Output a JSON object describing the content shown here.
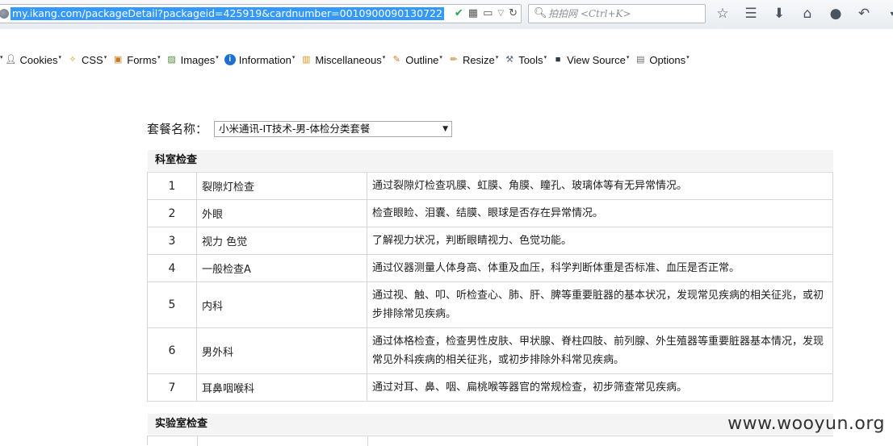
{
  "browser": {
    "url": "my.ikang.com/packageDetail?packageid=425919&cardnumber=0010900090130722",
    "search_placeholder": "拍拍网 <Ctrl+K>"
  },
  "devtoolbar": {
    "items": [
      {
        "label": "Cookies",
        "icon": "person-icon",
        "color": "#333333"
      },
      {
        "label": "CSS",
        "icon": "wand-icon",
        "color": "#d79a1f"
      },
      {
        "label": "Forms",
        "icon": "clipboard-icon",
        "color": "#c8791d"
      },
      {
        "label": "Images",
        "icon": "picture-icon",
        "color": "#4f8a3c"
      },
      {
        "label": "Information",
        "icon": "info-icon",
        "color": "#1f6fd1"
      },
      {
        "label": "Miscellaneous",
        "icon": "notebook-icon",
        "color": "#d7941a"
      },
      {
        "label": "Outline",
        "icon": "pencil-icon",
        "color": "#c8791d"
      },
      {
        "label": "Resize",
        "icon": "ruler-icon",
        "color": "#c8791d"
      },
      {
        "label": "Tools",
        "icon": "tools-icon",
        "color": "#5a6a7a"
      },
      {
        "label": "View Source",
        "icon": "monitor-icon",
        "color": "#2f3a44"
      },
      {
        "label": "Options",
        "icon": "options-icon",
        "color": "#6a6a6a"
      }
    ]
  },
  "package": {
    "label": "套餐名称：",
    "selected": "小米通讯-IT技术-男-体检分类套餐"
  },
  "sections": {
    "department": "科室检查",
    "lab": "实验室检查"
  },
  "rows": [
    {
      "num": "1",
      "name": "裂隙灯检查",
      "desc": "通过裂隙灯检查巩膜、虹膜、角膜、瞳孔、玻璃体等有无异常情况。"
    },
    {
      "num": "2",
      "name": "外眼",
      "desc": "检查眼睑、泪囊、结膜、眼球是否存在异常情况。"
    },
    {
      "num": "3",
      "name": "视力 色觉",
      "desc": "了解视力状况，判断眼睛视力、色觉功能。"
    },
    {
      "num": "4",
      "name": "一般检查A",
      "desc": "通过仪器测量人体身高、体重及血压，科学判断体重是否标准、血压是否正常。"
    },
    {
      "num": "5",
      "name": "内科",
      "desc": "通过视、触、叩、听检查心、肺、肝、脾等重要脏器的基本状况，发现常见疾病的相关征兆，或初步排除常见疾病。"
    },
    {
      "num": "6",
      "name": "男外科",
      "desc": "通过体格检查，检查男性皮肤、甲状腺、脊柱四肢、前列腺、外生殖器等重要脏器基本情况，发现常见外科疾病的相关征兆，或初步排除外科常见疾病。"
    },
    {
      "num": "7",
      "name": "耳鼻咽喉科",
      "desc": "通过对耳、鼻、咽、扁桃喉等器官的常规检查，初步筛查常见疾病。"
    }
  ],
  "watermark": "www.wooyun.org"
}
